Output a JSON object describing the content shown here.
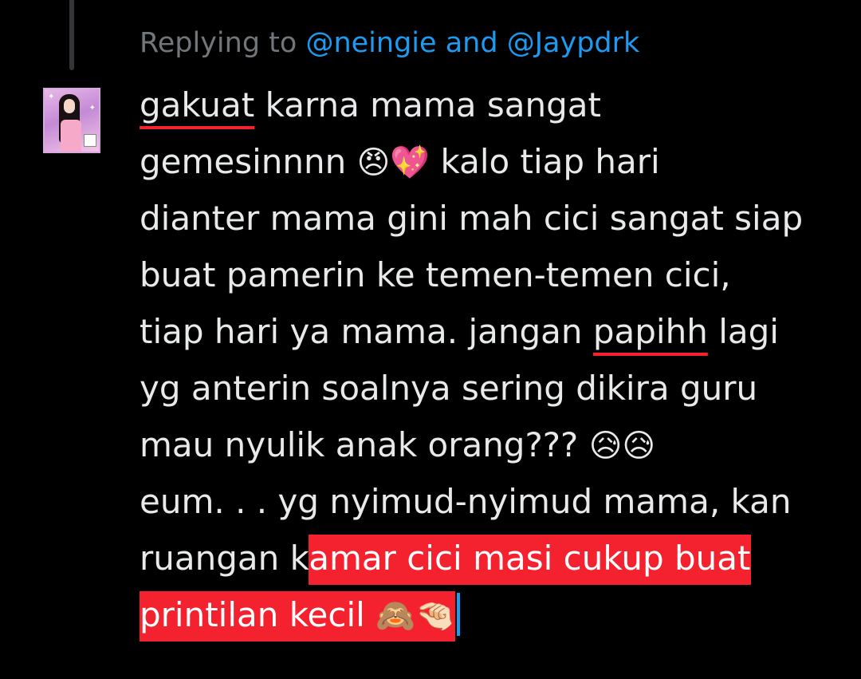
{
  "reply": {
    "prefix": "Replying to",
    "mention1": "@neingie",
    "conjunction": "and",
    "mention2": "@Jaypdrk"
  },
  "tweet": {
    "lines": [
      {
        "underlined": "gakuat",
        "rest": " karna mama sangat"
      },
      {
        "before": "gemesinnnn ",
        "emoji1": "😠",
        "emoji2": "💖",
        "after": " kalo tiap hari"
      },
      {
        "text": "dianter mama gini mah cici sangat siap"
      },
      {
        "text": "buat pamerin ke temen-temen cici,"
      },
      {
        "before": "tiap hari ya mama. jangan ",
        "underlined": "papihh",
        "after": " lagi"
      },
      {
        "text": "yg anterin soalnya sering dikira guru"
      },
      {
        "before": "mau nyulik anak orang??? ",
        "emoji1": "😥",
        "emoji2": "😥"
      },
      {
        "text": "eum. . . yg nyimud-nyimud mama, kan"
      },
      {
        "before": "ruangan k",
        "highlighted": "amar cici masi cukup buat"
      },
      {
        "highlighted": "printilan kecil ",
        "emoji1": "🙈",
        "emoji2": "🤏🏻"
      }
    ]
  },
  "colors": {
    "background": "#000000",
    "text": "#e7e9ea",
    "muted": "#71767b",
    "mention": "#1d9bf0",
    "highlight": "#f4212e"
  }
}
